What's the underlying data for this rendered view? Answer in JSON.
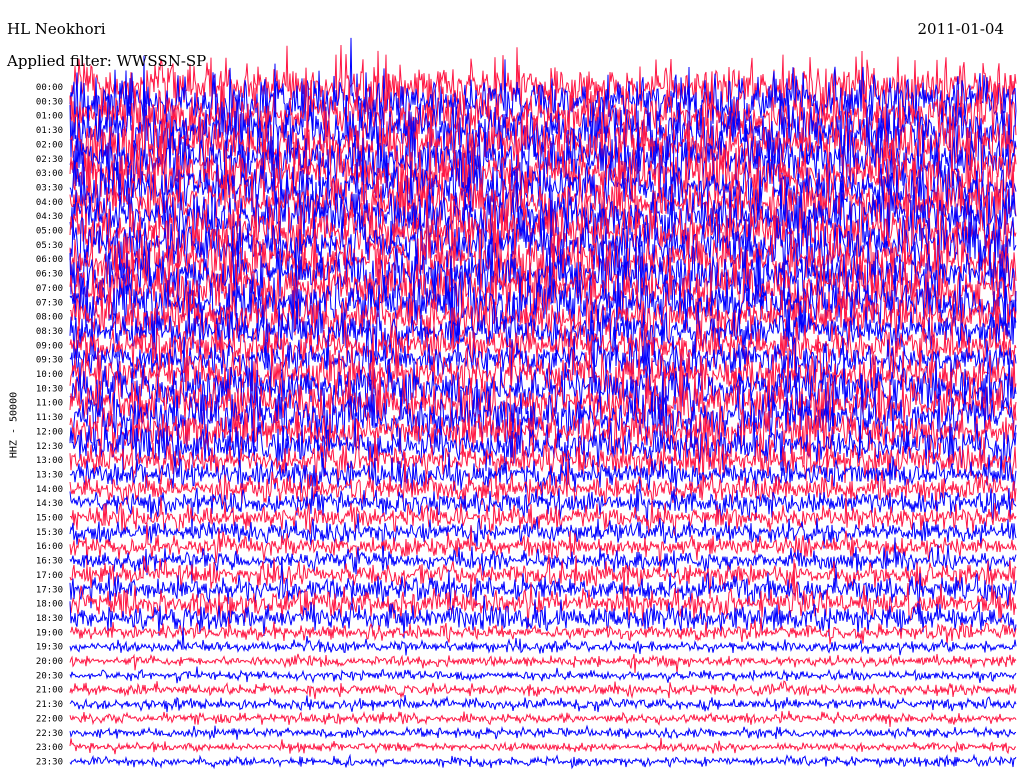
{
  "header": {
    "station": "HL Neokhori",
    "date": "2011-01-04",
    "filter": "Applied filter: WWSSN-SP"
  },
  "chart_data": {
    "type": "line",
    "title": "HL Neokhori",
    "date": "2011-01-04",
    "filter": "Applied filter: WWSSN-SP",
    "ylabel": "HHZ - 50000",
    "ytick_labels": [
      "00:00",
      "00:30",
      "01:00",
      "01:30",
      "02:00",
      "02:30",
      "03:00",
      "03:30",
      "04:00",
      "04:30",
      "05:00",
      "05:30",
      "06:00",
      "06:30",
      "07:00",
      "07:30",
      "08:00",
      "08:30",
      "09:00",
      "09:30",
      "10:00",
      "10:30",
      "11:00",
      "11:30",
      "12:00",
      "12:30",
      "13:00",
      "13:30",
      "14:00",
      "14:30",
      "15:00",
      "15:30",
      "16:00",
      "16:30",
      "17:00",
      "17:30",
      "18:00",
      "18:30",
      "19:00",
      "19:30",
      "20:00",
      "20:30",
      "21:00",
      "21:30",
      "22:00",
      "22:30",
      "23:00",
      "23:30"
    ],
    "series_colors": [
      "#ff1744",
      "#0000ff"
    ],
    "trace_amplitude": [
      3.0,
      3.0,
      3.0,
      3.0,
      3.0,
      3.0,
      3.0,
      3.0,
      3.0,
      3.0,
      3.0,
      3.0,
      3.0,
      3.0,
      3.0,
      3.0,
      2.6,
      2.4,
      2.0,
      2.0,
      2.4,
      2.6,
      2.8,
      2.8,
      2.4,
      2.2,
      1.8,
      1.6,
      1.5,
      1.4,
      1.3,
      1.2,
      1.1,
      1.1,
      1.3,
      1.5,
      1.6,
      1.5,
      0.9,
      0.6,
      0.55,
      0.55,
      0.6,
      0.6,
      0.55,
      0.55,
      0.5,
      0.5
    ],
    "grid": false,
    "legend": "none"
  }
}
